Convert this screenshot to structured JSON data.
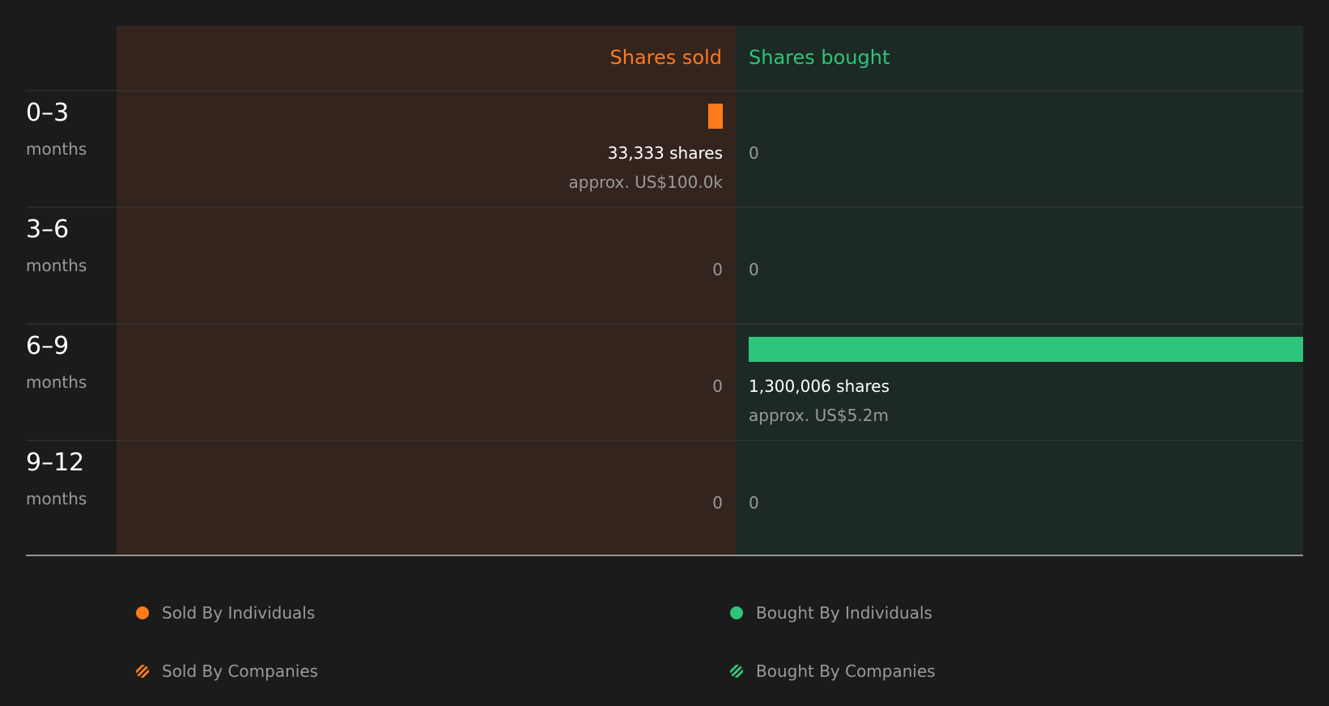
{
  "chart_data": {
    "type": "bar",
    "orientation": "horizontal-diverging",
    "column_headers": {
      "sold": "Shares sold",
      "bought": "Shares bought"
    },
    "categories": [
      {
        "range": "0–3",
        "unit": "months"
      },
      {
        "range": "3–6",
        "unit": "months"
      },
      {
        "range": "6–9",
        "unit": "months"
      },
      {
        "range": "9–12",
        "unit": "months"
      }
    ],
    "series": [
      {
        "key": "sold",
        "values": [
          33333,
          0,
          0,
          0
        ],
        "labels": [
          "33,333 shares",
          "0",
          "0",
          "0"
        ],
        "value_labels": [
          "approx. US$100.0k",
          "",
          "",
          ""
        ]
      },
      {
        "key": "bought",
        "values": [
          0,
          0,
          1300006,
          0
        ],
        "labels": [
          "0",
          "0",
          "1,300,006 shares",
          "0"
        ],
        "value_labels": [
          "",
          "",
          "approx. US$5.2m",
          ""
        ]
      }
    ],
    "max_value": 1300006,
    "legend": [
      {
        "label": "Sold By Individuals",
        "style": "solid",
        "color": "#ff7a1a"
      },
      {
        "label": "Bought By Individuals",
        "style": "solid",
        "color": "#2ec57a"
      },
      {
        "label": "Sold By Companies",
        "style": "striped",
        "color": "#ff7a1a"
      },
      {
        "label": "Bought By Companies",
        "style": "striped",
        "color": "#2ec57a"
      }
    ],
    "legend_position": "bottom",
    "colors": {
      "sold": "#ff7a1a",
      "bought": "#2ec57a",
      "sold_bg": "#33241d",
      "bought_bg": "#1c2924",
      "page_bg": "#1b1b1c",
      "text": "#ffffff",
      "muted": "#9a9a9a",
      "divider": "#3a3a3a",
      "axis": "#bdbdbd"
    }
  }
}
